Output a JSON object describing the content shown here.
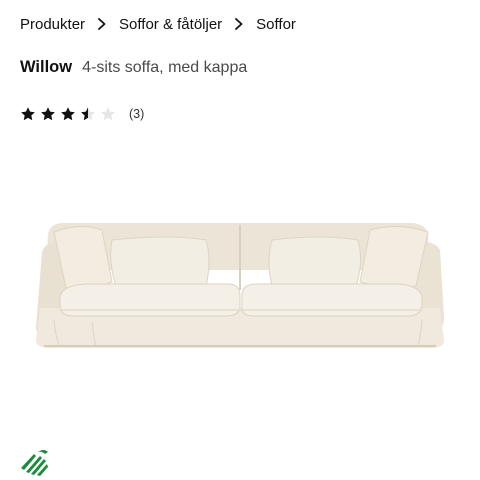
{
  "breadcrumb": {
    "items": [
      "Produkter",
      "Soffor & fåtöljer",
      "Soffor"
    ]
  },
  "product": {
    "name": "Willow",
    "description": "4-sits soffa, med kappa",
    "rating": {
      "value": 3.5,
      "max": 5,
      "count_label": "(3)"
    },
    "image_alt": "sofa-image",
    "sofa_color": "#efe8dc"
  },
  "eco_label": {
    "icon": "nordic-swan-ecolabel-icon",
    "color": "#1a8c3c"
  }
}
